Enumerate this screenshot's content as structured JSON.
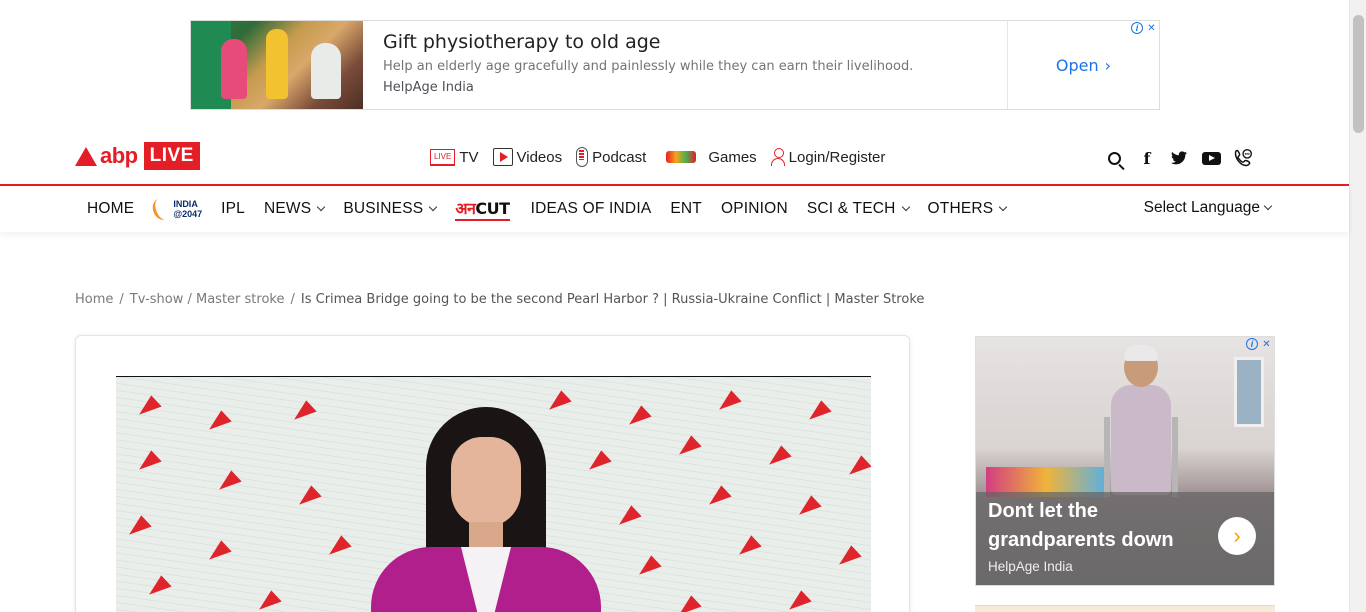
{
  "top_ad": {
    "title": "Gift physiotherapy to old age",
    "description": "Help an elderly age gracefully and painlessly while they can earn their livelihood.",
    "advertiser": "HelpAge India",
    "cta": "Open",
    "cta_icon": "chevron-right-icon",
    "adchoices_icon": "info-icon",
    "close_icon": "close-icon"
  },
  "header": {
    "logo_text": "abp",
    "logo_badge": "LIVE",
    "brand_color": "#e41e26",
    "top_links": [
      {
        "label": "TV",
        "icon": "live-tv-icon"
      },
      {
        "label": "Videos",
        "icon": "play-icon"
      },
      {
        "label": "Podcast",
        "icon": "microphone-icon"
      },
      {
        "label": "Games",
        "icon": "games-icon"
      },
      {
        "label": "Login/Register",
        "icon": "user-icon"
      }
    ],
    "social_icons": [
      "search-icon",
      "facebook-icon",
      "twitter-icon",
      "youtube-icon",
      "phone-icon"
    ]
  },
  "main_nav": {
    "items": [
      {
        "label": "HOME"
      },
      {
        "label": "INDIA\n@2047",
        "logo": true
      },
      {
        "label": "IPL"
      },
      {
        "label": "NEWS",
        "dropdown": true
      },
      {
        "label": "BUSINESS",
        "dropdown": true
      },
      {
        "label": "अनCUT",
        "logo": true
      },
      {
        "label": "IDEAS OF INDIA"
      },
      {
        "label": "ENT"
      },
      {
        "label": "OPINION"
      },
      {
        "label": "SCI & TECH",
        "dropdown": true
      },
      {
        "label": "OTHERS",
        "dropdown": true
      }
    ],
    "language_label": "Select Language",
    "india_top": "INDIA",
    "india_bottom": "@2047",
    "anncut_a": "अन",
    "anncut_b": "CUT"
  },
  "breadcrumb": {
    "home": "Home",
    "section": "Tv-show / Master stroke",
    "current": "Is Crimea Bridge going to be the second Pearl Harbor ? | Russia-Ukraine Conflict | Master Stroke",
    "separator": "/"
  },
  "side_ad": {
    "headline": "Dont let the grandparents down",
    "advertiser": "HelpAge India",
    "cta_icon": "chevron-right-icon",
    "cta_color": "#f0a500"
  }
}
